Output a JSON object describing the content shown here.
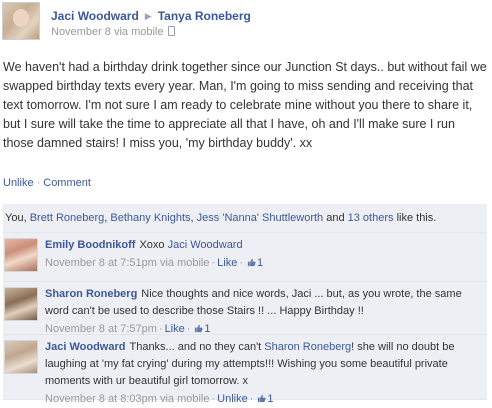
{
  "post": {
    "author": "Jaci Woodward",
    "target": "Tanya Roneberg",
    "arrow": "▶",
    "date": "November 8 via mobile",
    "text": "We haven't had a birthday drink together since our Junction St days.. but without fail we swapped birthday texts every year. Man, I'm going to miss sending and receiving that text tomorrow. I'm not sure I am ready to celebrate mine without you there to share it, but I sure will take the time to appreciate all that I have, oh and I'll make sure I run those damned stairs! I miss you, 'my birthday buddy'. xx"
  },
  "actions": {
    "unlike": "Unlike",
    "sep": "·",
    "comment": "Comment"
  },
  "likes": {
    "prefix": "You, ",
    "person1": "Brett Roneberg",
    "comma1": ", ",
    "person2": "Bethany Knights",
    "comma2": ", ",
    "person3": "Jess 'Nanna' Shuttleworth",
    "and": " and ",
    "others": "13 others",
    "suffix": " like this."
  },
  "comments": [
    {
      "author": "Emily Boodnikoff",
      "text_pre": "Xoxo ",
      "text_link": "Jaci Woodward",
      "text_post": "",
      "time": "November 8 at 7:51pm via mobile",
      "sep": "·",
      "action": "Like",
      "like_count": "1"
    },
    {
      "author": "Sharon Roneberg",
      "text_pre": "Nice thoughts and nice words, Jaci ... but, as you wrote, the same word can't be used to describe those Stairs !! ... Happy Birthday !!",
      "text_link": "",
      "text_post": "",
      "time": "November 8 at 7:57pm",
      "sep": "·",
      "action": "Like",
      "like_count": "1"
    },
    {
      "author": "Jaci Woodward",
      "text_pre": "Thanks... and no they can't ",
      "text_link": "Sharon Roneberg",
      "text_post": "! she will no doubt be laughing at 'my fat crying' during my attempts!!! Wishing you some beautiful private moments with ur beautiful girl tomorrow. x",
      "time": "November 8 at 8:03pm via mobile",
      "sep": "·",
      "action": "Unlike",
      "like_count": "1"
    }
  ],
  "colors": {
    "link": "#3b5998",
    "meta": "#999999",
    "box": "#edeff4"
  },
  "icons": {
    "like": "thumbs-up-icon",
    "mobile": "mobile-phone-icon"
  }
}
